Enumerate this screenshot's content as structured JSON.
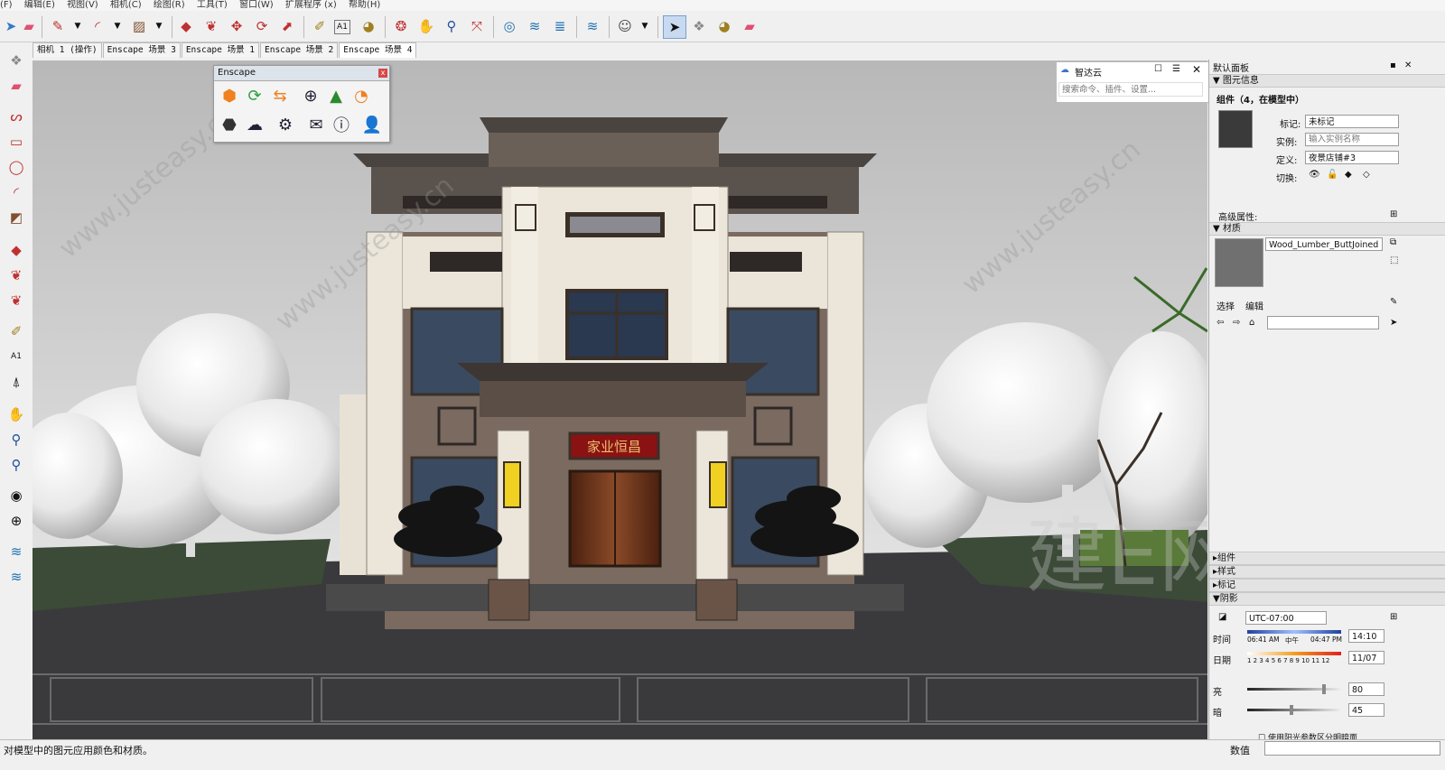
{
  "menu": [
    "(F)",
    "编辑(E)",
    "视图(V)",
    "相机(C)",
    "绘图(R)",
    "工具(T)",
    "窗口(W)",
    "扩展程序 (x)",
    "帮助(H)"
  ],
  "toolbar_icons": [
    "select-icon",
    "eraser-icon",
    "pencil-icon",
    "arc-icon",
    "rectangle-icon",
    "push-pull-icon",
    "follow-me-icon",
    "move-icon",
    "rotate-icon",
    "scale-icon",
    "tape-measure-icon",
    "text-icon",
    "paint-bucket-icon",
    "orbit-icon",
    "pan-icon",
    "zoom-icon",
    "zoom-extents-icon",
    "warehouse-icon",
    "extension-warehouse-icon",
    "layout-icon",
    "sandbox-icon",
    "account-icon",
    "select-arrow-icon",
    "component-icon",
    "paint-icon",
    "erase-icon"
  ],
  "scene_tabs": [
    "相机 1 (操作)",
    "Enscape 场景 3",
    "Enscape 场景 1",
    "Enscape 场景 2",
    "Enscape 场景 4"
  ],
  "active_tab_index": 4,
  "enscape": {
    "title": "Enscape",
    "close": "x"
  },
  "zhida": {
    "title": "智达云",
    "search_placeholder": "搜索命令、插件、设置..."
  },
  "building": {
    "sign_text": "家业恒昌"
  },
  "right_panel": {
    "title": "默认面板",
    "entity_info_header": "图元信息",
    "entity_title": "组件（4，在模型中）",
    "tag_label": "标记:",
    "tag_value": "未标记",
    "instance_label": "实例:",
    "instance_placeholder": "输入实例名称",
    "definition_label": "定义:",
    "definition_value": "夜景店铺#3",
    "toggle_label": "切换:",
    "advanced_label": "高级属性:",
    "materials_header": "材质",
    "material_name": "Wood_Lumber_ButtJoined",
    "select_tab": "选择",
    "edit_tab": "编辑",
    "components_header": "组件",
    "styles_header": "样式",
    "tags_header": "标记",
    "shadows_header": "阴影",
    "timezone": "UTC-07:00",
    "time_label": "时间",
    "time_start": "06:41 AM",
    "time_noon": "中午",
    "time_end": "04:47 PM",
    "time_value": "14:10",
    "date_label": "日期",
    "months": "1 2 3 4 5 6 7 8 9 10 11 12",
    "date_value": "11/07",
    "light_label": "亮",
    "light_value": "80",
    "dark_label": "暗",
    "dark_value": "45",
    "light_level": 0.8,
    "dark_level": 0.45,
    "time_level": 0.78,
    "date_level": 0.85,
    "checkbox_label": "使用阳光参数区分明暗面"
  },
  "status": {
    "hint": "对模型中的图元应用颜色和材质。",
    "value_label": "数值"
  },
  "watermarks": [
    "www.justeasy.cn",
    "建E网"
  ],
  "colors": {
    "accent": "#3a78c8",
    "close_red": "#d84848",
    "sign_red": "#8b1212"
  }
}
